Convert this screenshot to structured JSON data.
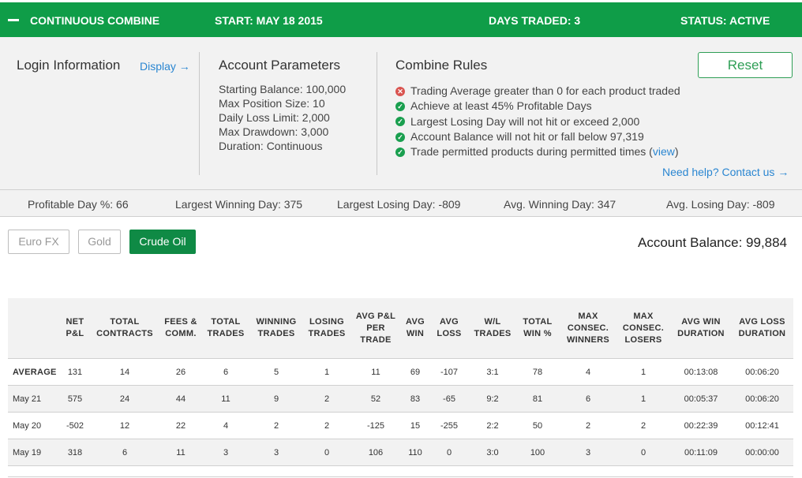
{
  "header": {
    "title": "CONTINUOUS COMBINE",
    "start": "START: MAY 18 2015",
    "days_traded": "DAYS TRADED: 3",
    "status": "STATUS: ACTIVE"
  },
  "login": {
    "title": "Login Information",
    "display_link": "Display →"
  },
  "params": {
    "title": "Account Parameters",
    "items": [
      "Starting Balance: 100,000",
      "Max Position Size: 10",
      "Daily Loss Limit: 2,000",
      "Max Drawdown: 3,000",
      "Duration: Continuous"
    ]
  },
  "rules": {
    "title": "Combine Rules",
    "items": [
      {
        "text": "Trading Average greater than 0 for each product traded",
        "status": "fail"
      },
      {
        "text": "Achieve at least 45% Profitable Days",
        "status": "pass"
      },
      {
        "text": "Largest Losing Day will not hit or exceed 2,000",
        "status": "pass"
      },
      {
        "text": "Account Balance will not hit or fall below 97,319",
        "status": "pass"
      },
      {
        "text": "Trade permitted products during permitted times (",
        "status": "pass"
      }
    ],
    "view_link": "view",
    "close_paren": ")",
    "help_link": "Need help? Contact us →"
  },
  "reset_label": "Reset",
  "stats": {
    "profitable_day": "Profitable Day %: 66",
    "largest_win": "Largest Winning Day: 375",
    "largest_loss": "Largest Losing Day: -809",
    "avg_win": "Avg. Winning Day: 347",
    "avg_loss": "Avg. Losing Day: -809"
  },
  "products": [
    "Euro FX",
    "Gold",
    "Crude Oil"
  ],
  "active_product": "Crude Oil",
  "account_balance": "Account Balance: 99,884",
  "table": {
    "headers": [
      "",
      "NET P&L",
      "TOTAL CONTRACTS",
      "FEES & COMM.",
      "TOTAL TRADES",
      "WINNING TRADES",
      "LOSING TRADES",
      "AVG P&L PER TRADE",
      "AVG WIN",
      "AVG LOSS",
      "W/L TRADES",
      "TOTAL WIN %",
      "MAX CONSEC. WINNERS",
      "MAX CONSEC. LOSERS",
      "AVG WIN DURATION",
      "AVG LOSS DURATION"
    ],
    "rows": [
      [
        "AVERAGE",
        "131",
        "14",
        "26",
        "6",
        "5",
        "1",
        "11",
        "69",
        "-107",
        "3:1",
        "78",
        "4",
        "1",
        "00:13:08",
        "00:06:20"
      ],
      [
        "May 21",
        "575",
        "24",
        "44",
        "11",
        "9",
        "2",
        "52",
        "83",
        "-65",
        "9:2",
        "81",
        "6",
        "1",
        "00:05:37",
        "00:06:20"
      ],
      [
        "May 20",
        "-502",
        "12",
        "22",
        "4",
        "2",
        "2",
        "-125",
        "15",
        "-255",
        "2:2",
        "50",
        "2",
        "2",
        "00:22:39",
        "00:12:41"
      ],
      [
        "May 19",
        "318",
        "6",
        "11",
        "3",
        "3",
        "0",
        "106",
        "110",
        "0",
        "3:0",
        "100",
        "3",
        "0",
        "00:11:09",
        "00:00:00"
      ]
    ]
  },
  "colors": {
    "brand_green": "#0f9d48",
    "active_button": "#0f8a45",
    "link_blue": "#2a86d1",
    "fail_red": "#d9534f"
  }
}
